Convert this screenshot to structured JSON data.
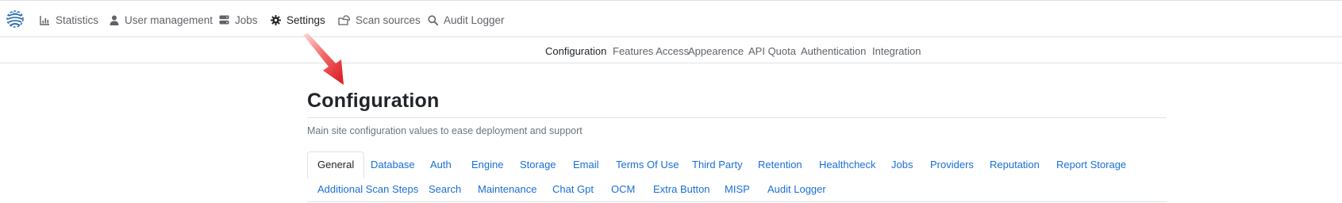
{
  "navbar": {
    "items": [
      {
        "label": "Statistics",
        "icon": "bar-chart-icon"
      },
      {
        "label": "User management",
        "icon": "user-icon"
      },
      {
        "label": "Jobs",
        "icon": "server-icon"
      },
      {
        "label": "Settings",
        "icon": "gear-icon",
        "active": true
      },
      {
        "label": "Scan sources",
        "icon": "cloud-folder-icon"
      },
      {
        "label": "Audit Logger",
        "icon": "search-icon"
      }
    ]
  },
  "subnav": {
    "items": [
      "Configuration",
      "Features Access",
      "Appearence",
      "API Quota",
      "Authentication",
      "Integration"
    ],
    "active": "Configuration"
  },
  "page": {
    "title": "Configuration",
    "description": "Main site configuration values to ease deployment and support"
  },
  "tabs": {
    "row1": [
      "General",
      "Database",
      "Auth",
      "Engine",
      "Storage",
      "Email",
      "Terms Of Use",
      "Third Party",
      "Retention",
      "Healthcheck",
      "Jobs",
      "Providers",
      "Reputation",
      "Report Storage"
    ],
    "row2": [
      "Additional Scan Steps",
      "Search",
      "Maintenance",
      "Chat Gpt",
      "OCM",
      "Extra Button",
      "MISP",
      "Audit Logger"
    ],
    "active": "General"
  },
  "colors": {
    "link": "#1a6fd6",
    "annotation_arrow": "#e8232a"
  }
}
